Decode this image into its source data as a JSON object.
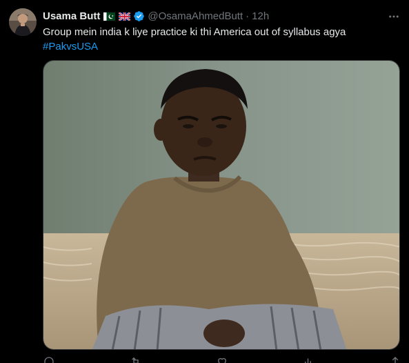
{
  "tweet": {
    "author_name": "Usama Butt",
    "flags": [
      "pakistan-flag-icon",
      "uk-flag-icon"
    ],
    "handle": "@OsamaAhmedButt",
    "separator": "·",
    "time": "12h",
    "text_line1": "Group mein india k liye practice ki thi America out of syllabus agya",
    "hashtag": "#PakvsUSA",
    "media_description_icon": "photo-icon",
    "actions": [
      {
        "icon": "reply-icon",
        "count": ""
      },
      {
        "icon": "retweet-icon",
        "count": ""
      },
      {
        "icon": "like-icon",
        "count": ""
      },
      {
        "icon": "views-icon",
        "count": ""
      },
      {
        "icon": "share-icon",
        "count": ""
      }
    ]
  },
  "colors": {
    "background": "#000000",
    "text": "#e7e9ea",
    "muted": "#71767b",
    "link": "#1d9bf0",
    "verified": "#1d9bf0"
  }
}
